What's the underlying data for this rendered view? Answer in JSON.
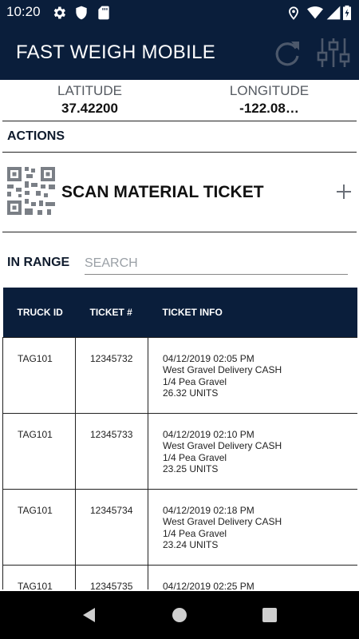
{
  "status_bar": {
    "time": "10:20",
    "icons": [
      "gear-icon",
      "shield-icon",
      "sd-card-icon",
      "location-icon",
      "wifi-icon",
      "signal-icon",
      "battery-charging-icon"
    ]
  },
  "app_bar": {
    "title": "FAST WEIGH MOBILE",
    "actions": [
      "refresh-icon",
      "settings-sliders-icon"
    ],
    "background": "#0a1e3b"
  },
  "location": {
    "latitude_label": "LATITUDE",
    "latitude_value": "37.42200",
    "longitude_label": "LONGITUDE",
    "longitude_value": "-122.08…"
  },
  "actions": {
    "title": "ACTIONS",
    "scan_label": "SCAN MATERIAL TICKET",
    "scan_icon": "qr-code-icon",
    "add_icon": "plus-icon"
  },
  "in_range": {
    "title": "IN RANGE",
    "search_placeholder": "SEARCH",
    "search_value": ""
  },
  "table": {
    "headers": [
      "TRUCK ID",
      "TICKET #",
      "TICKET INFO"
    ],
    "rows": [
      {
        "truck_id": "TAG101",
        "ticket": "12345732",
        "info": [
          "04/12/2019 02:05 PM",
          "West Gravel Delivery CASH",
          "1/4 Pea Gravel",
          "26.32 UNITS"
        ]
      },
      {
        "truck_id": "TAG101",
        "ticket": "12345733",
        "info": [
          "04/12/2019 02:10 PM",
          "West Gravel Delivery CASH",
          "1/4 Pea Gravel",
          "23.25 UNITS"
        ]
      },
      {
        "truck_id": "TAG101",
        "ticket": "12345734",
        "info": [
          "04/12/2019 02:18 PM",
          "West Gravel Delivery CASH",
          "1/4 Pea Gravel",
          "23.24 UNITS"
        ]
      },
      {
        "truck_id": "TAG101",
        "ticket": "12345735",
        "info": [
          "04/12/2019 02:25 PM",
          "",
          "",
          ""
        ]
      }
    ]
  },
  "nav_bar": {
    "buttons": [
      "back-icon",
      "home-icon",
      "recents-icon"
    ]
  }
}
